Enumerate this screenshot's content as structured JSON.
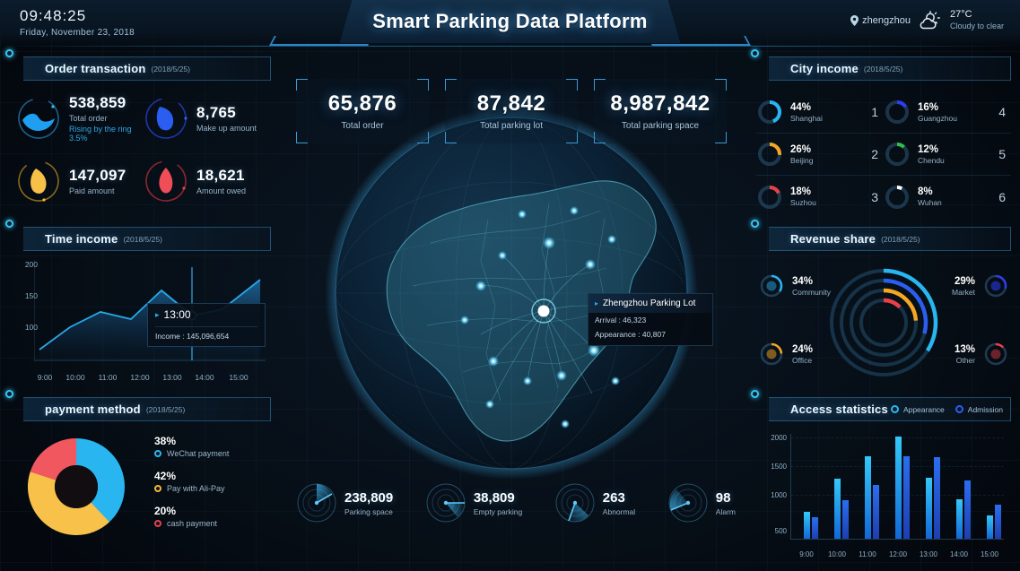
{
  "header": {
    "time": "09:48:25",
    "date": "Friday, November 23, 2018",
    "title": "Smart Parking Data Platform",
    "location": "zhengzhou",
    "location_icon": "map-pin-icon",
    "weather_icon": "cloudy-sun-icon",
    "temperature": "27°C",
    "weather_desc": "Cloudy to clear"
  },
  "order_transaction": {
    "title": "Order transaction",
    "date": "(2018/5/25)",
    "stats": [
      {
        "value": "538,859",
        "label": "Total order",
        "sub": "Rising by the ring 3.5%",
        "color": "#29a8e8"
      },
      {
        "value": "8,765",
        "label": "Make up amount",
        "sub": "",
        "color": "#2b5ef0"
      },
      {
        "value": "147,097",
        "label": "Paid amount",
        "sub": "",
        "color": "#f0b councils"
      },
      {
        "value": "18,621",
        "label": "Amount owed",
        "sub": "",
        "color": "#e8404a"
      }
    ]
  },
  "time_income": {
    "title": "Time income",
    "date": "(2018/5/25)",
    "tooltip": {
      "time": "13:00",
      "income_label": "Income : 145,096,654"
    }
  },
  "payment_method": {
    "title": "payment method",
    "date": "(2018/5/25)",
    "items": [
      {
        "pct": "38%",
        "name": "WeChat payment",
        "color": "#29b6f0"
      },
      {
        "pct": "42%",
        "name": "Pay with Ali-Pay",
        "color": "#f5b731"
      },
      {
        "pct": "20%",
        "name": "cash payment",
        "color": "#e8404a"
      }
    ]
  },
  "kpis": [
    {
      "value": "65,876",
      "label": "Total order"
    },
    {
      "value": "87,842",
      "label": "Total parking lot"
    },
    {
      "value": "8,987,842",
      "label": "Total parking space"
    }
  ],
  "map_tooltip": {
    "title": "Zhengzhou  Parking Lot",
    "arrival": "Arrival : 46,323",
    "appearance": "Appearance : 40,807"
  },
  "bottom_stats": [
    {
      "value": "238,809",
      "label": "Parking space",
      "icon": "radar-gauge-icon"
    },
    {
      "value": "38,809",
      "label": "Empty parking",
      "icon": "radar-gauge-icon"
    },
    {
      "value": "263",
      "label": "Abnormal",
      "icon": "radar-gauge-icon"
    },
    {
      "value": "98",
      "label": "Alarm",
      "icon": "radar-gauge-icon"
    }
  ],
  "city_income": {
    "title": "City income",
    "date": "(2018/5/25)",
    "cities": [
      {
        "pct": "44%",
        "name": "Shanghai",
        "rank": "1",
        "color": "#29b6f0"
      },
      {
        "pct": "16%",
        "name": "Guangzhou",
        "rank": "4",
        "color": "#2b3ef0"
      },
      {
        "pct": "26%",
        "name": "Beijing",
        "rank": "2",
        "color": "#f5a623"
      },
      {
        "pct": "12%",
        "name": "Chendu",
        "rank": "5",
        "color": "#2fbf4a"
      },
      {
        "pct": "18%",
        "name": "Suzhou",
        "rank": "3",
        "color": "#e8404a"
      },
      {
        "pct": "8%",
        "name": "Wuhan",
        "rank": "6",
        "color": "#ffffff"
      }
    ]
  },
  "revenue_share": {
    "title": "Revenue share",
    "date": "(2018/5/25)",
    "items": [
      {
        "pct": "34%",
        "name": "Community",
        "color": "#29b6f0"
      },
      {
        "pct": "29%",
        "name": "Market",
        "color": "#2b3ef0"
      },
      {
        "pct": "24%",
        "name": "Office",
        "color": "#f5a623"
      },
      {
        "pct": "13%",
        "name": "Other",
        "color": "#e8404a"
      }
    ]
  },
  "access_statistics": {
    "title": "Access statistics",
    "legend": [
      {
        "label": "Appearance",
        "color": "#29b6f0"
      },
      {
        "label": "Admission",
        "color": "#2b5ef0"
      }
    ]
  },
  "chart_data": [
    {
      "type": "area",
      "name": "time_income",
      "title": "Time income",
      "x": [
        "9:00",
        "10:00",
        "11:00",
        "12:00",
        "13:00",
        "14:00",
        "15:00"
      ],
      "xlabel": "",
      "ylabel": "",
      "ylim": [
        75,
        230
      ],
      "yticks": [
        100,
        150,
        200
      ],
      "grid": false,
      "series": [
        {
          "name": "Income",
          "values": [
            85,
            118,
            148,
            136,
            190,
            143,
            152,
            205
          ]
        }
      ],
      "highlight": {
        "x": "13:00",
        "y": 143,
        "label": "Income : 145,096,654"
      }
    },
    {
      "type": "pie",
      "name": "payment_method",
      "title": "payment method",
      "labels": [
        "WeChat payment",
        "Pay with Ali-Pay",
        "cash payment"
      ],
      "values": [
        38,
        42,
        20
      ],
      "colors": [
        "#29b6f0",
        "#f5b731",
        "#e8404a"
      ],
      "legend": "right"
    },
    {
      "type": "bar",
      "name": "access_statistics",
      "title": "Access statistics",
      "categories": [
        "9:00",
        "10:00",
        "11:00",
        "12:00",
        "13:00",
        "14:00",
        "15:00"
      ],
      "xlabel": "",
      "ylabel": "",
      "ylim": [
        500,
        2300
      ],
      "yticks": [
        500,
        1000,
        1500,
        2000
      ],
      "grid": true,
      "legend": "top-right",
      "series": [
        {
          "name": "Appearance",
          "color": "#29b6f0",
          "values": [
            930,
            1440,
            1820,
            2250,
            1450,
            1100,
            880
          ]
        },
        {
          "name": "Admission",
          "color": "#2b5ef0",
          "values": [
            850,
            1080,
            1320,
            1820,
            1800,
            1400,
            1000
          ]
        }
      ]
    },
    {
      "type": "pie",
      "name": "revenue_share",
      "title": "Revenue share",
      "labels": [
        "Community",
        "Market",
        "Office",
        "Other"
      ],
      "values": [
        34,
        29,
        24,
        13
      ],
      "colors": [
        "#29b6f0",
        "#2b3ef0",
        "#f5a623",
        "#e8404a"
      ]
    },
    {
      "type": "bar",
      "name": "city_income",
      "title": "City income",
      "categories": [
        "Shanghai",
        "Beijing",
        "Suzhou",
        "Guangzhou",
        "Chendu",
        "Wuhan"
      ],
      "values": [
        44,
        26,
        18,
        16,
        12,
        8
      ],
      "ylabel": "%"
    }
  ]
}
